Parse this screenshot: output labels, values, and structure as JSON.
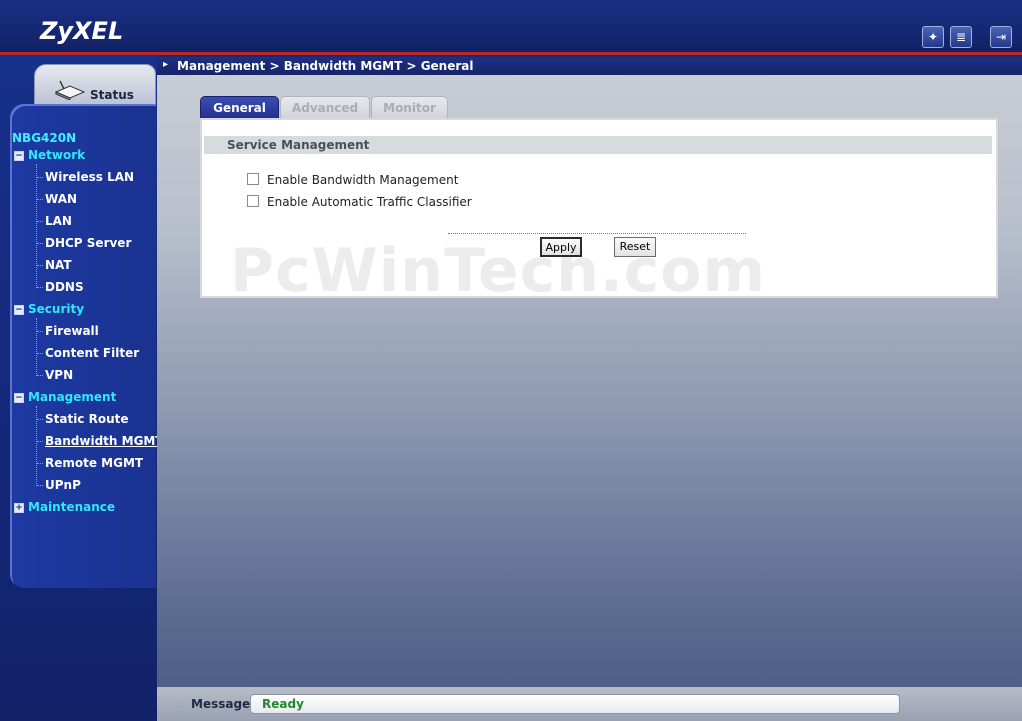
{
  "header": {
    "logo": "ZyXEL",
    "icons": [
      "wizard-icon",
      "about-icon",
      "logout-icon"
    ]
  },
  "breadcrumb": "Management > Bandwidth MGMT > General",
  "sidebar": {
    "status_label": "Status",
    "model": "NBG420N",
    "groups": [
      {
        "label": "Network",
        "expanded": true,
        "items": [
          "Wireless LAN",
          "WAN",
          "LAN",
          "DHCP Server",
          "NAT",
          "DDNS"
        ]
      },
      {
        "label": "Security",
        "expanded": true,
        "items": [
          "Firewall",
          "Content Filter",
          "VPN"
        ]
      },
      {
        "label": "Management",
        "expanded": true,
        "items": [
          "Static Route",
          "Bandwidth MGMT",
          "Remote MGMT",
          "UPnP"
        ]
      },
      {
        "label": "Maintenance",
        "expanded": false,
        "items": []
      }
    ],
    "active_item": "Bandwidth MGMT"
  },
  "tabs": {
    "general": "General",
    "advanced": "Advanced",
    "monitor": "Monitor"
  },
  "section": {
    "title": "Service Management",
    "options": [
      {
        "label": "Enable Bandwidth Management",
        "checked": false
      },
      {
        "label": "Enable Automatic Traffic Classifier",
        "checked": false
      }
    ]
  },
  "buttons": {
    "apply": "Apply",
    "reset": "Reset"
  },
  "watermark": "PcWinTech.com",
  "footer": {
    "label": "Message",
    "status": "Ready"
  },
  "colors": {
    "accent": "#2ee8ff",
    "header": "#142670",
    "status_ok": "#1e8a2c"
  }
}
